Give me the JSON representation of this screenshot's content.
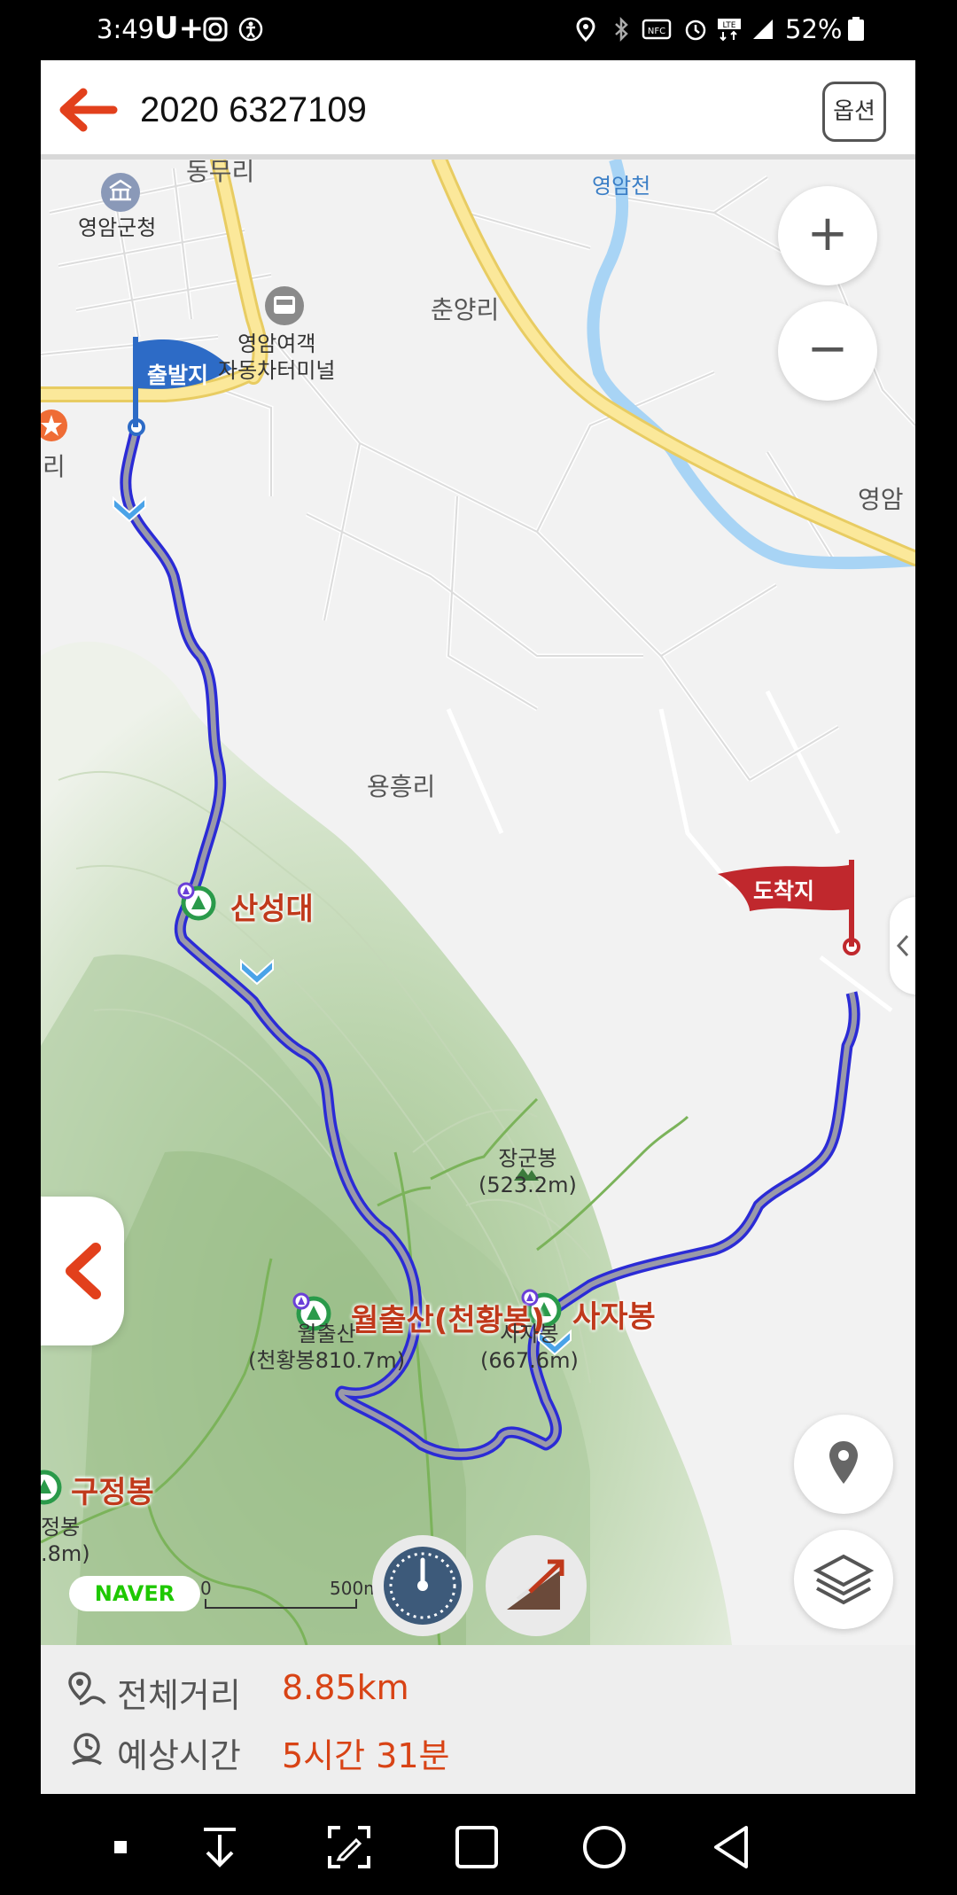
{
  "status_bar": {
    "time": "3:49",
    "carrier": "U+",
    "battery_text": "52%",
    "icons": [
      "instagram-icon",
      "accessibility-icon",
      "location-icon",
      "bluetooth-icon",
      "nfc-icon",
      "alarm-icon",
      "lte-icon",
      "signal-icon",
      "battery-icon"
    ]
  },
  "header": {
    "title": "2020 6327109",
    "option_label": "옵션",
    "back_icon": "arrow-left-icon"
  },
  "map": {
    "places": {
      "county_office": "영암군청",
      "bus_terminal_line1": "영암여객",
      "bus_terminal_line2": "자동차터미널",
      "chunyang": "춘양리",
      "yongheung": "용흥리",
      "yeongamcheon": "영암천",
      "yeongam_right": "영암",
      "dongmuri": "동무리",
      "ri_left": "리"
    },
    "flags": {
      "start": "출발지",
      "end": "도착지"
    },
    "peaks": {
      "sanseongdae": "산성대",
      "wolchulsan": "월출산(천황봉)",
      "sajabong": "사자봉",
      "gujeongbong": "구정봉"
    },
    "poi": {
      "janggunbong_name": "장군봉",
      "janggunbong_height": "(523.2m)",
      "wolchulsan_name": "월출산",
      "wolchulsan_height": "(천황봉810.7m)",
      "sajabong_name": "사자봉",
      "sajabong_height": "(667.6m)",
      "gujeong_name": "정봉",
      "gujeong_height": ".8m)"
    },
    "naver": "NAVER",
    "scale_start": "0",
    "scale_end": "500m",
    "zoom_in": "+",
    "zoom_out": "−",
    "colors": {
      "route": "#2b2bd6",
      "route_fill": "#9a9aa8",
      "start_flag": "#2d6bc6",
      "end_flag": "#c0282d",
      "peak_text": "#c0391b"
    }
  },
  "info": {
    "distance_label": "전체거리",
    "distance_value": "8.85km",
    "time_label": "예상시간",
    "time_value": "5시간 31분"
  },
  "nav_bar": {
    "buttons": [
      "dot-icon",
      "download-icon",
      "screenshot-edit-icon",
      "recent-apps-icon",
      "home-icon",
      "back-icon"
    ]
  }
}
